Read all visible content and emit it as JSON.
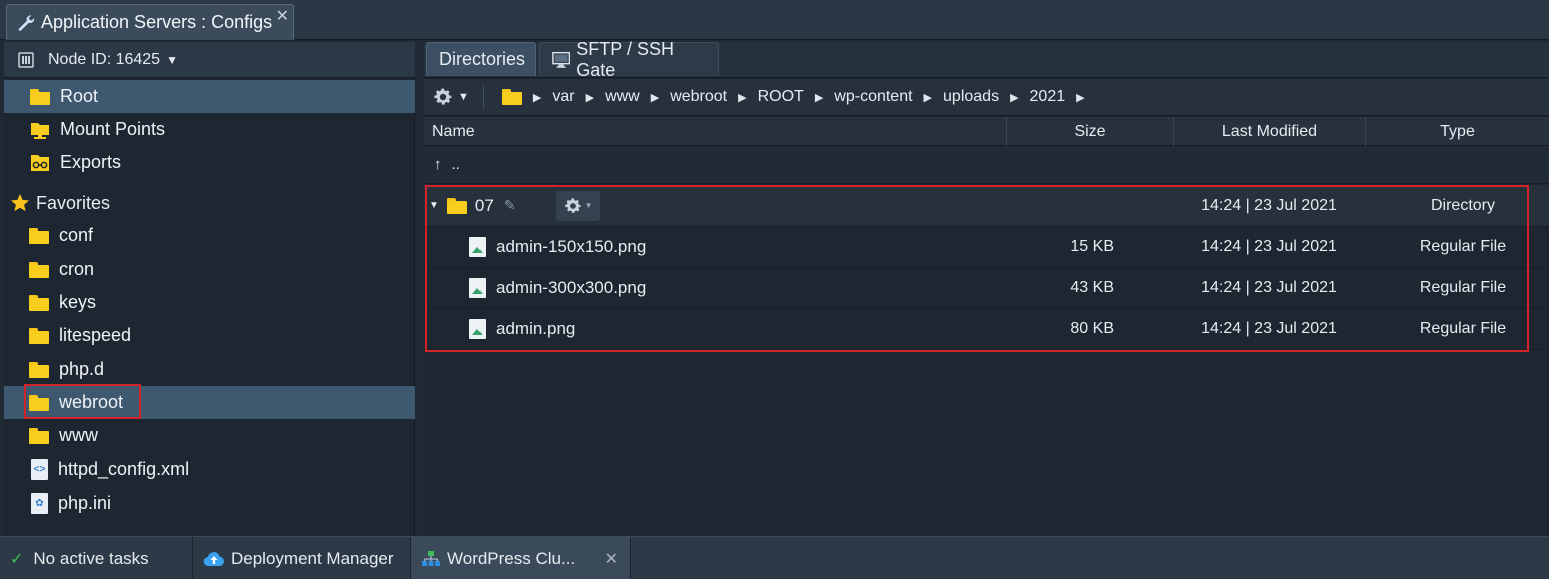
{
  "window_tab": {
    "title": "Application Servers : Configs",
    "close": "✕"
  },
  "node": {
    "label": "Node ID: 16425"
  },
  "tree": {
    "top_items": [
      {
        "label": "Root",
        "icon": "folder-icon",
        "selected": true
      },
      {
        "label": "Mount Points",
        "icon": "mount-folder-icon"
      },
      {
        "label": "Exports",
        "icon": "exports-icon"
      }
    ],
    "favorites_label": "Favorites",
    "favorites": [
      {
        "label": "conf",
        "type": "folder"
      },
      {
        "label": "cron",
        "type": "folder"
      },
      {
        "label": "keys",
        "type": "folder"
      },
      {
        "label": "litespeed",
        "type": "folder"
      },
      {
        "label": "php.d",
        "type": "folder"
      },
      {
        "label": "webroot",
        "type": "folder",
        "selected": true
      },
      {
        "label": "www",
        "type": "folder"
      },
      {
        "label": "httpd_config.xml",
        "type": "xml"
      },
      {
        "label": "php.ini",
        "type": "ini"
      }
    ]
  },
  "panel_tabs": [
    {
      "label": "Directories",
      "active": true
    },
    {
      "label": "SFTP / SSH Gate",
      "active": false
    }
  ],
  "breadcrumb": [
    "var",
    "www",
    "webroot",
    "ROOT",
    "wp-content",
    "uploads",
    "2021"
  ],
  "columns": {
    "name": "Name",
    "size": "Size",
    "modified": "Last Modified",
    "type": "Type"
  },
  "parent_row": {
    "arrow": "↑",
    "label": ".."
  },
  "files": [
    {
      "name": "07",
      "size": "",
      "modified": "14:24 | 23 Jul 2021",
      "type": "Directory",
      "kind": "folder"
    },
    {
      "name": "admin-150x150.png",
      "size": "15 KB",
      "modified": "14:24 | 23 Jul 2021",
      "type": "Regular File",
      "kind": "image"
    },
    {
      "name": "admin-300x300.png",
      "size": "43 KB",
      "modified": "14:24 | 23 Jul 2021",
      "type": "Regular File",
      "kind": "image"
    },
    {
      "name": "admin.png",
      "size": "80 KB",
      "modified": "14:24 | 23 Jul 2021",
      "type": "Regular File",
      "kind": "image"
    }
  ],
  "bottom_tabs": [
    {
      "label": "No active tasks",
      "icon": "check-icon"
    },
    {
      "label": "Deployment Manager",
      "icon": "cloud-upload-icon"
    },
    {
      "label": "WordPress Clu...",
      "icon": "cluster-icon",
      "active": true,
      "close": "✕"
    }
  ],
  "colors": {
    "highlight": "#d2232a",
    "folder": "#f7cd1e",
    "selected": "#3e5870"
  }
}
